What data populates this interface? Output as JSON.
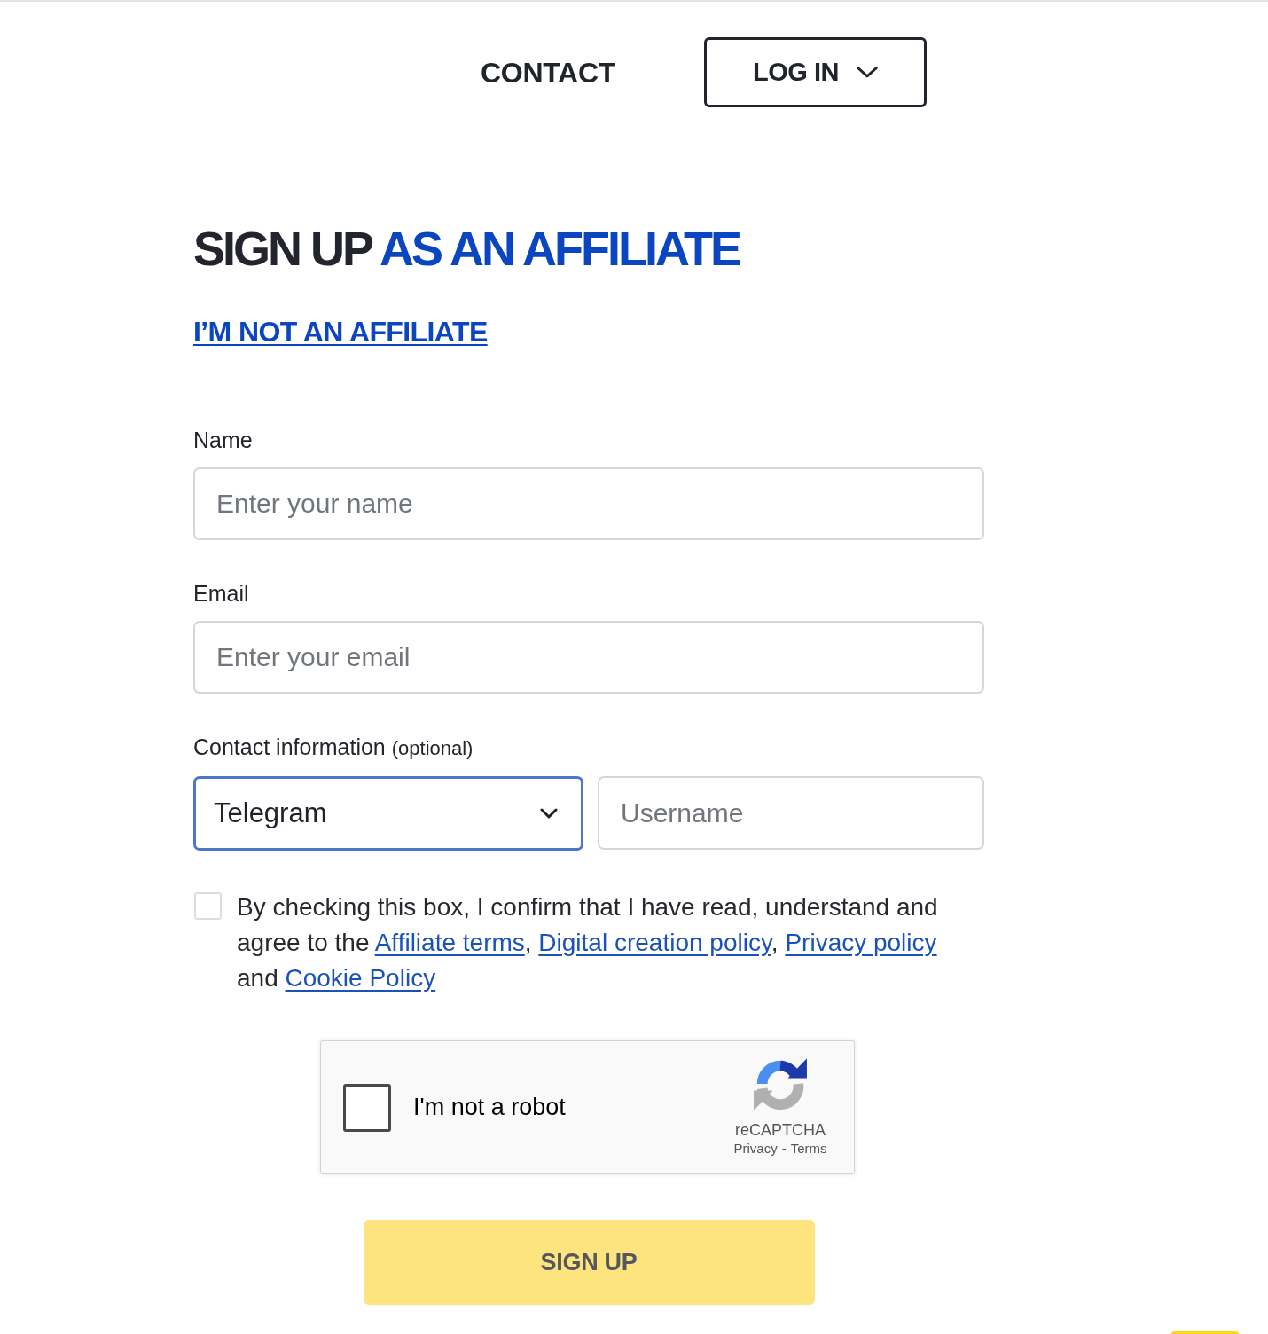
{
  "nav": {
    "links": [
      {
        "label": "CONTACT"
      }
    ],
    "login_button": {
      "label": "LOG IN"
    }
  },
  "heading": {
    "parts": [
      {
        "kind": "plain",
        "text": "SIGN UP"
      },
      {
        "kind": "accent",
        "text": "AS AN AFFILIATE"
      }
    ]
  },
  "switch_link": {
    "label": "I’M NOT AN AFFILIATE"
  },
  "form": {
    "fields": [
      {
        "kind": "text",
        "label": "Name",
        "placeholder": "Enter your name"
      },
      {
        "kind": "text",
        "label": "Email",
        "placeholder": "Enter your email"
      },
      {
        "kind": "contact",
        "label": "Contact information",
        "label_note": "(optional)",
        "select": {
          "value": "Telegram",
          "focused": true
        },
        "input": {
          "placeholder": "Username"
        }
      }
    ]
  },
  "consent": {
    "checked": false,
    "parts": [
      {
        "kind": "text",
        "text": "By checking this box, I confirm that I have read, understand and agree to the "
      },
      {
        "kind": "link",
        "text": "Affiliate terms"
      },
      {
        "kind": "text",
        "text": ", "
      },
      {
        "kind": "link",
        "text": "Digital creation policy"
      },
      {
        "kind": "text",
        "text": ", "
      },
      {
        "kind": "link",
        "text": "Privacy policy"
      },
      {
        "kind": "text",
        "text": " and "
      },
      {
        "kind": "link",
        "text": "Cookie Policy"
      }
    ]
  },
  "recaptcha": {
    "checked": false,
    "label": "I'm not a robot",
    "brand": "reCAPTCHA",
    "links": [
      {
        "label": "Privacy"
      },
      {
        "label": "Terms"
      }
    ],
    "separator": "-"
  },
  "submit_button": {
    "label": "SIGN UP",
    "disabled": true
  }
}
